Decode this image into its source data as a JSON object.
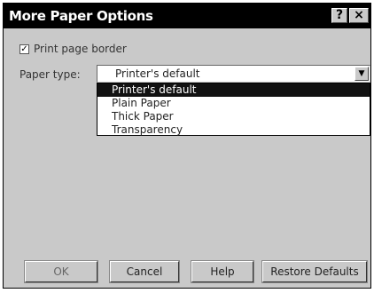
{
  "window": {
    "title": "More Paper Options",
    "help_glyph": "?",
    "close_glyph": "×"
  },
  "border_checkbox": {
    "label": "Print page border",
    "checked": true,
    "check_glyph": "✓"
  },
  "paper_type": {
    "label": "Paper type:",
    "selected_value": "Printer's default",
    "arrow_glyph": "▼",
    "options": [
      "Printer's default",
      "Plain Paper",
      "Thick Paper",
      "Transparency"
    ]
  },
  "buttons": {
    "ok": "OK",
    "cancel": "Cancel",
    "help": "Help",
    "restore": "Restore Defaults"
  },
  "colors": {
    "dialog_bg": "#c9c9c9",
    "titlebar_bg": "#000000",
    "highlight_bg": "#111111"
  }
}
